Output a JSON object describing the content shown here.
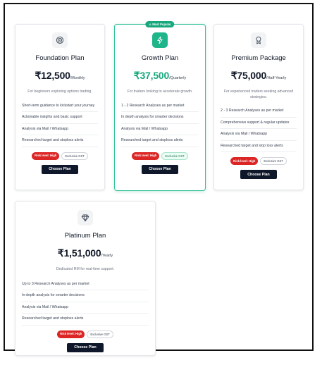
{
  "colors": {
    "accent_green": "#17a87d",
    "risk_red": "#dc2626",
    "button_dark": "#0f172a"
  },
  "plans": [
    {
      "icon": "target-icon",
      "name": "Foundation Plan",
      "price": "₹12,500",
      "period": "/Monthly",
      "description": "For beginners exploring options trading.",
      "features": [
        "Short-term guidance to kickstart your journey",
        "Actionable insights and basic support",
        "Analysis via Mail / Whatsapp",
        "Researched target and stoploss alerts"
      ],
      "risk_badge": "Risk level: High",
      "gst_badge": "Exclusive GST",
      "button": "Choose Plan"
    },
    {
      "icon": "lightning-icon",
      "badge": "Most Popular",
      "name": "Growth Plan",
      "price": "₹37,500",
      "period": "/Quarterly",
      "description": "For traders looking to accelerate growth.",
      "features": [
        "1 - 2 Research Analyses as per market",
        "In depth analysis for smarter decisions",
        "Analysis via Mail / Whatsapp",
        "Researched target and stoploss alerts"
      ],
      "risk_badge": "Risk level: High",
      "gst_badge": "Exclusive GST",
      "button": "Choose Plan"
    },
    {
      "icon": "award-icon",
      "name": "Premium Package",
      "price": "₹75,000",
      "period": "/Half-Yearly",
      "description": "For experienced traders seeking advanced strategies.",
      "features": [
        "2 - 3 Research Analyses as per market",
        "Comprehensive support & regular updates",
        "Analysis via Mail / Whatsapp",
        "Researched target and stop loss alerts"
      ],
      "risk_badge": "Risk level: High",
      "gst_badge": "Exclusive GST",
      "button": "Choose Plan"
    },
    {
      "icon": "diamond-icon",
      "name": "Platinum Plan",
      "price": "₹1,51,000",
      "period": "/Yearly",
      "description": "Dedicated RM for real-time support.",
      "features": [
        "Up to 3 Research Analyses as per market",
        "In-depth analysis for smarter decisions",
        "Analysis via Mail / Whatsapp",
        "Researched target and stoploss alerts"
      ],
      "risk_badge": "Risk level: High",
      "gst_badge": "Exclusive GST",
      "button": "Choose Plan"
    }
  ]
}
